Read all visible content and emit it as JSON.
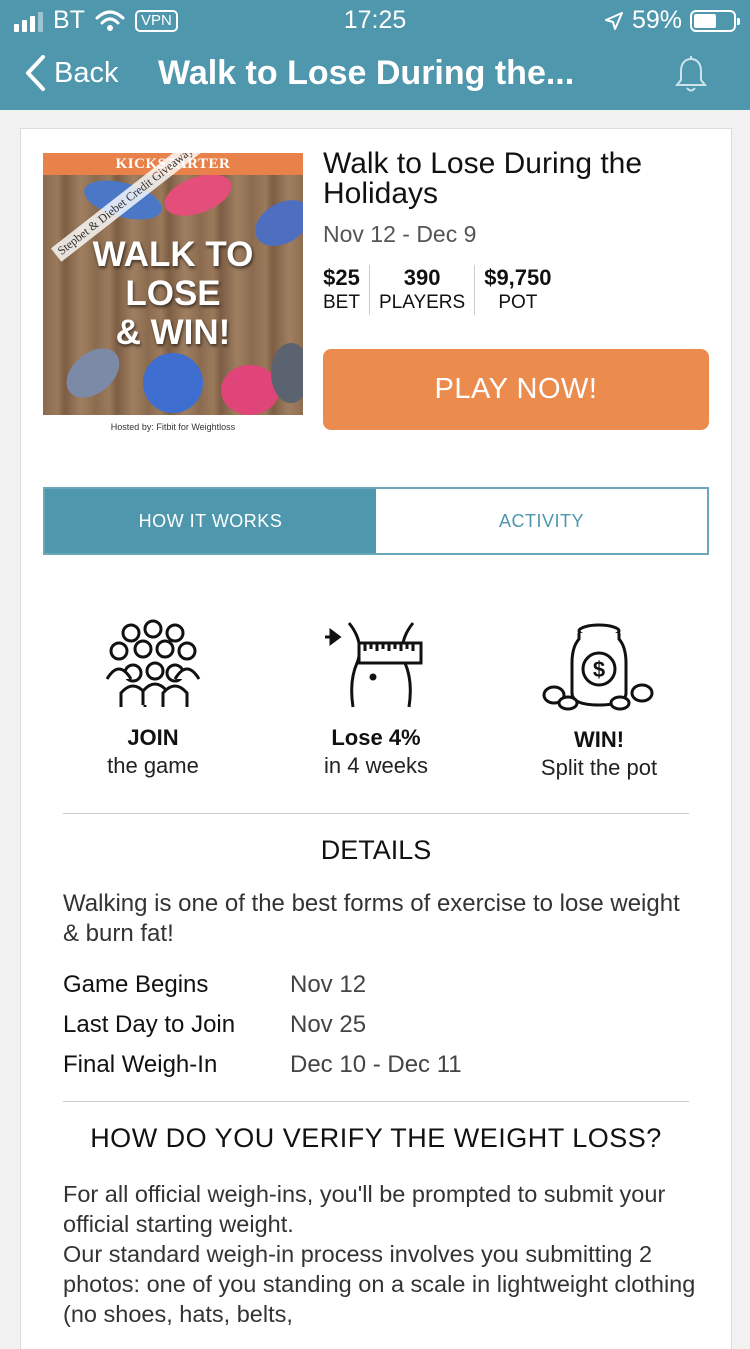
{
  "status_bar": {
    "carrier": "BT",
    "vpn": "VPN",
    "time": "17:25",
    "battery": "59%",
    "battery_level": 0.59
  },
  "nav": {
    "back_label": "Back",
    "title": "Walk to Lose During the..."
  },
  "poster": {
    "banner": "KICKSTARTER",
    "promo": "Stepbet & Diebet Credit Giveaways",
    "headline": [
      "WALK TO",
      "LOSE",
      "& WIN!"
    ],
    "hosted_by": "Hosted by:  Fitbit for Weightloss"
  },
  "game": {
    "title": "Walk to Lose During the Holidays",
    "dates": "Nov 12 - Dec 9",
    "stats": [
      {
        "value": "$25",
        "label": "BET"
      },
      {
        "value": "390",
        "label": "PLAYERS"
      },
      {
        "value": "$9,750",
        "label": "POT"
      }
    ],
    "play_label": "PLAY NOW!"
  },
  "tabs": [
    {
      "label": "HOW IT WORKS",
      "active": true
    },
    {
      "label": "ACTIVITY",
      "active": false
    }
  ],
  "steps": [
    {
      "icon": "group-icon",
      "title": "JOIN",
      "subtitle": "the game"
    },
    {
      "icon": "waist-tape-icon",
      "title": "Lose 4%",
      "subtitle": "in 4 weeks"
    },
    {
      "icon": "money-jar-icon",
      "title": "WIN!",
      "subtitle": "Split the pot"
    }
  ],
  "details": {
    "heading": "DETAILS",
    "description": "Walking is one of the best forms of exercise to lose weight & burn fat!",
    "rows": [
      {
        "label": "Game Begins",
        "value": "Nov 12"
      },
      {
        "label": "Last Day to Join",
        "value": "Nov 25"
      },
      {
        "label": "Final Weigh-In",
        "value": "Dec 10 - Dec 11"
      }
    ]
  },
  "verify": {
    "heading": "HOW DO YOU VERIFY THE WEIGHT LOSS?",
    "line1": "For all official weigh-ins, you'll be prompted to submit your official starting weight.",
    "line2": "Our standard weigh-in process involves you submitting 2 photos: one of you standing on a scale in lightweight clothing (no shoes, hats, belts,"
  },
  "colors": {
    "header": "#4f97ad",
    "accent": "#ec8b4e",
    "tab_border": "#6aa7b8"
  }
}
